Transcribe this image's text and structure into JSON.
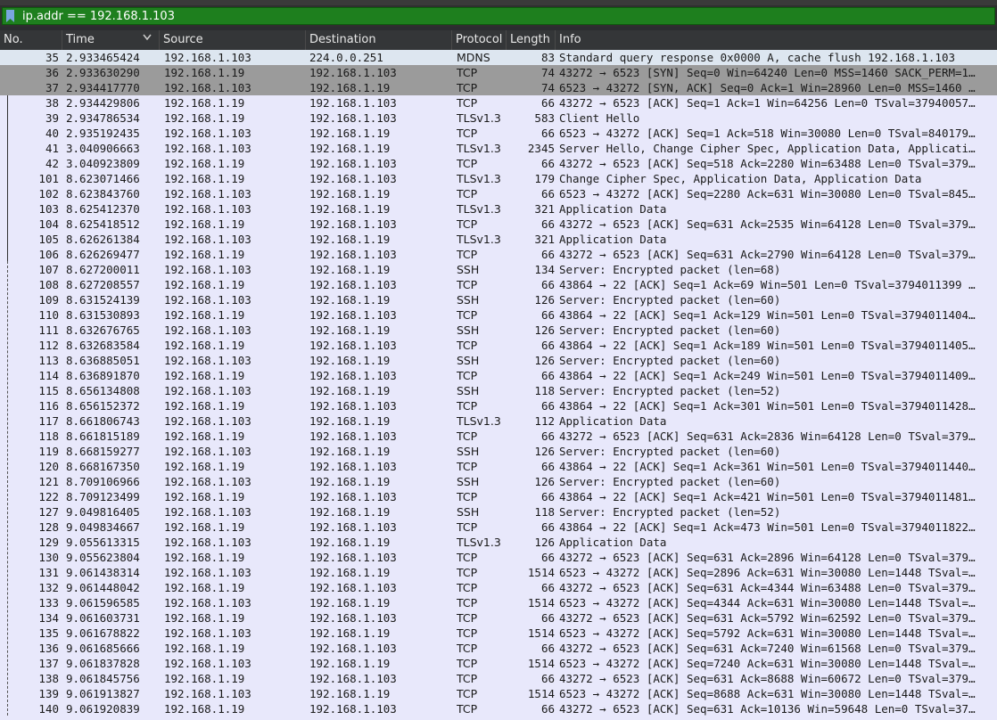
{
  "filter": {
    "value": "ip.addr == 192.168.1.103",
    "valid_color": "#1e7f1e"
  },
  "columns": {
    "no": "No.",
    "time": "Time",
    "source": "Source",
    "destination": "Destination",
    "protocol": "Protocol",
    "length": "Length",
    "info": "Info"
  },
  "packets": [
    {
      "no": "35",
      "time": "2.933465424",
      "src": "192.168.1.103",
      "dst": "224.0.0.251",
      "proto": "MDNS",
      "len": "83",
      "info": "Standard query response 0x0000 A, cache flush 192.168.1.103"
    },
    {
      "no": "36",
      "time": "2.933630290",
      "src": "192.168.1.19",
      "dst": "192.168.1.103",
      "proto": "TCP",
      "len": "74",
      "info": "43272 → 6523 [SYN] Seq=0 Win=64240 Len=0 MSS=1460 SACK_PERM=1…"
    },
    {
      "no": "37",
      "time": "2.934417770",
      "src": "192.168.1.103",
      "dst": "192.168.1.19",
      "proto": "TCP",
      "len": "74",
      "info": "6523 → 43272 [SYN, ACK] Seq=0 Ack=1 Win=28960 Len=0 MSS=1460 …"
    },
    {
      "no": "38",
      "time": "2.934429806",
      "src": "192.168.1.19",
      "dst": "192.168.1.103",
      "proto": "TCP",
      "len": "66",
      "info": "43272 → 6523 [ACK] Seq=1 Ack=1 Win=64256 Len=0 TSval=37940057…"
    },
    {
      "no": "39",
      "time": "2.934786534",
      "src": "192.168.1.19",
      "dst": "192.168.1.103",
      "proto": "TLSv1.3",
      "len": "583",
      "info": "Client Hello"
    },
    {
      "no": "40",
      "time": "2.935192435",
      "src": "192.168.1.103",
      "dst": "192.168.1.19",
      "proto": "TCP",
      "len": "66",
      "info": "6523 → 43272 [ACK] Seq=1 Ack=518 Win=30080 Len=0 TSval=840179…"
    },
    {
      "no": "41",
      "time": "3.040906663",
      "src": "192.168.1.103",
      "dst": "192.168.1.19",
      "proto": "TLSv1.3",
      "len": "2345",
      "info": "Server Hello, Change Cipher Spec, Application Data, Applicati…"
    },
    {
      "no": "42",
      "time": "3.040923809",
      "src": "192.168.1.19",
      "dst": "192.168.1.103",
      "proto": "TCP",
      "len": "66",
      "info": "43272 → 6523 [ACK] Seq=518 Ack=2280 Win=63488 Len=0 TSval=379…"
    },
    {
      "no": "101",
      "time": "8.623071466",
      "src": "192.168.1.19",
      "dst": "192.168.1.103",
      "proto": "TLSv1.3",
      "len": "179",
      "info": "Change Cipher Spec, Application Data, Application Data"
    },
    {
      "no": "102",
      "time": "8.623843760",
      "src": "192.168.1.103",
      "dst": "192.168.1.19",
      "proto": "TCP",
      "len": "66",
      "info": "6523 → 43272 [ACK] Seq=2280 Ack=631 Win=30080 Len=0 TSval=845…"
    },
    {
      "no": "103",
      "time": "8.625412370",
      "src": "192.168.1.103",
      "dst": "192.168.1.19",
      "proto": "TLSv1.3",
      "len": "321",
      "info": "Application Data"
    },
    {
      "no": "104",
      "time": "8.625418512",
      "src": "192.168.1.19",
      "dst": "192.168.1.103",
      "proto": "TCP",
      "len": "66",
      "info": "43272 → 6523 [ACK] Seq=631 Ack=2535 Win=64128 Len=0 TSval=379…"
    },
    {
      "no": "105",
      "time": "8.626261384",
      "src": "192.168.1.103",
      "dst": "192.168.1.19",
      "proto": "TLSv1.3",
      "len": "321",
      "info": "Application Data"
    },
    {
      "no": "106",
      "time": "8.626269477",
      "src": "192.168.1.19",
      "dst": "192.168.1.103",
      "proto": "TCP",
      "len": "66",
      "info": "43272 → 6523 [ACK] Seq=631 Ack=2790 Win=64128 Len=0 TSval=379…"
    },
    {
      "no": "107",
      "time": "8.627200011",
      "src": "192.168.1.103",
      "dst": "192.168.1.19",
      "proto": "SSH",
      "len": "134",
      "info": "Server: Encrypted packet (len=68)"
    },
    {
      "no": "108",
      "time": "8.627208557",
      "src": "192.168.1.19",
      "dst": "192.168.1.103",
      "proto": "TCP",
      "len": "66",
      "info": "43864 → 22 [ACK] Seq=1 Ack=69 Win=501 Len=0 TSval=3794011399 …"
    },
    {
      "no": "109",
      "time": "8.631524139",
      "src": "192.168.1.103",
      "dst": "192.168.1.19",
      "proto": "SSH",
      "len": "126",
      "info": "Server: Encrypted packet (len=60)"
    },
    {
      "no": "110",
      "time": "8.631530893",
      "src": "192.168.1.19",
      "dst": "192.168.1.103",
      "proto": "TCP",
      "len": "66",
      "info": "43864 → 22 [ACK] Seq=1 Ack=129 Win=501 Len=0 TSval=3794011404…"
    },
    {
      "no": "111",
      "time": "8.632676765",
      "src": "192.168.1.103",
      "dst": "192.168.1.19",
      "proto": "SSH",
      "len": "126",
      "info": "Server: Encrypted packet (len=60)"
    },
    {
      "no": "112",
      "time": "8.632683584",
      "src": "192.168.1.19",
      "dst": "192.168.1.103",
      "proto": "TCP",
      "len": "66",
      "info": "43864 → 22 [ACK] Seq=1 Ack=189 Win=501 Len=0 TSval=3794011405…"
    },
    {
      "no": "113",
      "time": "8.636885051",
      "src": "192.168.1.103",
      "dst": "192.168.1.19",
      "proto": "SSH",
      "len": "126",
      "info": "Server: Encrypted packet (len=60)"
    },
    {
      "no": "114",
      "time": "8.636891870",
      "src": "192.168.1.19",
      "dst": "192.168.1.103",
      "proto": "TCP",
      "len": "66",
      "info": "43864 → 22 [ACK] Seq=1 Ack=249 Win=501 Len=0 TSval=3794011409…"
    },
    {
      "no": "115",
      "time": "8.656134808",
      "src": "192.168.1.103",
      "dst": "192.168.1.19",
      "proto": "SSH",
      "len": "118",
      "info": "Server: Encrypted packet (len=52)"
    },
    {
      "no": "116",
      "time": "8.656152372",
      "src": "192.168.1.19",
      "dst": "192.168.1.103",
      "proto": "TCP",
      "len": "66",
      "info": "43864 → 22 [ACK] Seq=1 Ack=301 Win=501 Len=0 TSval=3794011428…"
    },
    {
      "no": "117",
      "time": "8.661806743",
      "src": "192.168.1.103",
      "dst": "192.168.1.19",
      "proto": "TLSv1.3",
      "len": "112",
      "info": "Application Data"
    },
    {
      "no": "118",
      "time": "8.661815189",
      "src": "192.168.1.19",
      "dst": "192.168.1.103",
      "proto": "TCP",
      "len": "66",
      "info": "43272 → 6523 [ACK] Seq=631 Ack=2836 Win=64128 Len=0 TSval=379…"
    },
    {
      "no": "119",
      "time": "8.668159277",
      "src": "192.168.1.103",
      "dst": "192.168.1.19",
      "proto": "SSH",
      "len": "126",
      "info": "Server: Encrypted packet (len=60)"
    },
    {
      "no": "120",
      "time": "8.668167350",
      "src": "192.168.1.19",
      "dst": "192.168.1.103",
      "proto": "TCP",
      "len": "66",
      "info": "43864 → 22 [ACK] Seq=1 Ack=361 Win=501 Len=0 TSval=3794011440…"
    },
    {
      "no": "121",
      "time": "8.709106966",
      "src": "192.168.1.103",
      "dst": "192.168.1.19",
      "proto": "SSH",
      "len": "126",
      "info": "Server: Encrypted packet (len=60)"
    },
    {
      "no": "122",
      "time": "8.709123499",
      "src": "192.168.1.19",
      "dst": "192.168.1.103",
      "proto": "TCP",
      "len": "66",
      "info": "43864 → 22 [ACK] Seq=1 Ack=421 Win=501 Len=0 TSval=3794011481…"
    },
    {
      "no": "127",
      "time": "9.049816405",
      "src": "192.168.1.103",
      "dst": "192.168.1.19",
      "proto": "SSH",
      "len": "118",
      "info": "Server: Encrypted packet (len=52)"
    },
    {
      "no": "128",
      "time": "9.049834667",
      "src": "192.168.1.19",
      "dst": "192.168.1.103",
      "proto": "TCP",
      "len": "66",
      "info": "43864 → 22 [ACK] Seq=1 Ack=473 Win=501 Len=0 TSval=3794011822…"
    },
    {
      "no": "129",
      "time": "9.055613315",
      "src": "192.168.1.103",
      "dst": "192.168.1.19",
      "proto": "TLSv1.3",
      "len": "126",
      "info": "Application Data"
    },
    {
      "no": "130",
      "time": "9.055623804",
      "src": "192.168.1.19",
      "dst": "192.168.1.103",
      "proto": "TCP",
      "len": "66",
      "info": "43272 → 6523 [ACK] Seq=631 Ack=2896 Win=64128 Len=0 TSval=379…"
    },
    {
      "no": "131",
      "time": "9.061438314",
      "src": "192.168.1.103",
      "dst": "192.168.1.19",
      "proto": "TCP",
      "len": "1514",
      "info": "6523 → 43272 [ACK] Seq=2896 Ack=631 Win=30080 Len=1448 TSval=…"
    },
    {
      "no": "132",
      "time": "9.061448042",
      "src": "192.168.1.19",
      "dst": "192.168.1.103",
      "proto": "TCP",
      "len": "66",
      "info": "43272 → 6523 [ACK] Seq=631 Ack=4344 Win=63488 Len=0 TSval=379…"
    },
    {
      "no": "133",
      "time": "9.061596585",
      "src": "192.168.1.103",
      "dst": "192.168.1.19",
      "proto": "TCP",
      "len": "1514",
      "info": "6523 → 43272 [ACK] Seq=4344 Ack=631 Win=30080 Len=1448 TSval=…"
    },
    {
      "no": "134",
      "time": "9.061603731",
      "src": "192.168.1.19",
      "dst": "192.168.1.103",
      "proto": "TCP",
      "len": "66",
      "info": "43272 → 6523 [ACK] Seq=631 Ack=5792 Win=62592 Len=0 TSval=379…"
    },
    {
      "no": "135",
      "time": "9.061678822",
      "src": "192.168.1.103",
      "dst": "192.168.1.19",
      "proto": "TCP",
      "len": "1514",
      "info": "6523 → 43272 [ACK] Seq=5792 Ack=631 Win=30080 Len=1448 TSval=…"
    },
    {
      "no": "136",
      "time": "9.061685666",
      "src": "192.168.1.19",
      "dst": "192.168.1.103",
      "proto": "TCP",
      "len": "66",
      "info": "43272 → 6523 [ACK] Seq=631 Ack=7240 Win=61568 Len=0 TSval=379…"
    },
    {
      "no": "137",
      "time": "9.061837828",
      "src": "192.168.1.103",
      "dst": "192.168.1.19",
      "proto": "TCP",
      "len": "1514",
      "info": "6523 → 43272 [ACK] Seq=7240 Ack=631 Win=30080 Len=1448 TSval=…"
    },
    {
      "no": "138",
      "time": "9.061845756",
      "src": "192.168.1.19",
      "dst": "192.168.1.103",
      "proto": "TCP",
      "len": "66",
      "info": "43272 → 6523 [ACK] Seq=631 Ack=8688 Win=60672 Len=0 TSval=379…"
    },
    {
      "no": "139",
      "time": "9.061913827",
      "src": "192.168.1.103",
      "dst": "192.168.1.19",
      "proto": "TCP",
      "len": "1514",
      "info": "6523 → 43272 [ACK] Seq=8688 Ack=631 Win=30080 Len=1448 TSval=…"
    },
    {
      "no": "140",
      "time": "9.061920839",
      "src": "192.168.1.19",
      "dst": "192.168.1.103",
      "proto": "TCP",
      "len": "66",
      "info": "43272 → 6523 [ACK] Seq=631 Ack=10136 Win=59648 Len=0 TSval=37…"
    }
  ],
  "selected_packets": [
    "36",
    "37"
  ],
  "row_color": "#e8e8fb",
  "header_color": "#343638"
}
